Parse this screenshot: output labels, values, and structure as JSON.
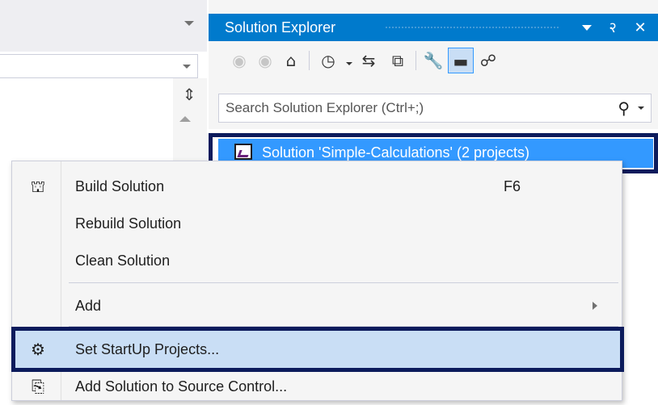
{
  "solution_explorer": {
    "title": "Solution Explorer",
    "pin_glyph": "२",
    "close_glyph": "✕",
    "search_placeholder": "Search Solution Explorer (Ctrl+;)",
    "solution_item": "Solution 'Simple-Calculations' (2 projects)",
    "toolbar_icons": [
      "back-icon",
      "forward-icon",
      "home-icon",
      "history-icon",
      "sync-icon",
      "collapse-icon",
      "properties-icon",
      "preview-icon",
      "class-view-icon"
    ]
  },
  "context_menu": {
    "items": [
      {
        "label": "Build Solution",
        "shortcut": "F6",
        "icon": "build-icon"
      },
      {
        "label": "Rebuild Solution",
        "shortcut": "",
        "icon": ""
      },
      {
        "label": "Clean Solution",
        "shortcut": "",
        "icon": ""
      },
      {
        "label": "Add",
        "shortcut": "",
        "icon": "",
        "has_submenu": true
      },
      {
        "label": "Set StartUp Projects...",
        "shortcut": "",
        "icon": "gear-icon",
        "highlighted": true
      },
      {
        "label": "Add Solution to Source Control...",
        "shortcut": "",
        "icon": "add-source-control-icon"
      }
    ]
  },
  "colors": {
    "accent": "#007acc",
    "selection": "#3399ff",
    "menu_highlight": "#c9def5",
    "callout_frame": "#0c1b5c"
  }
}
